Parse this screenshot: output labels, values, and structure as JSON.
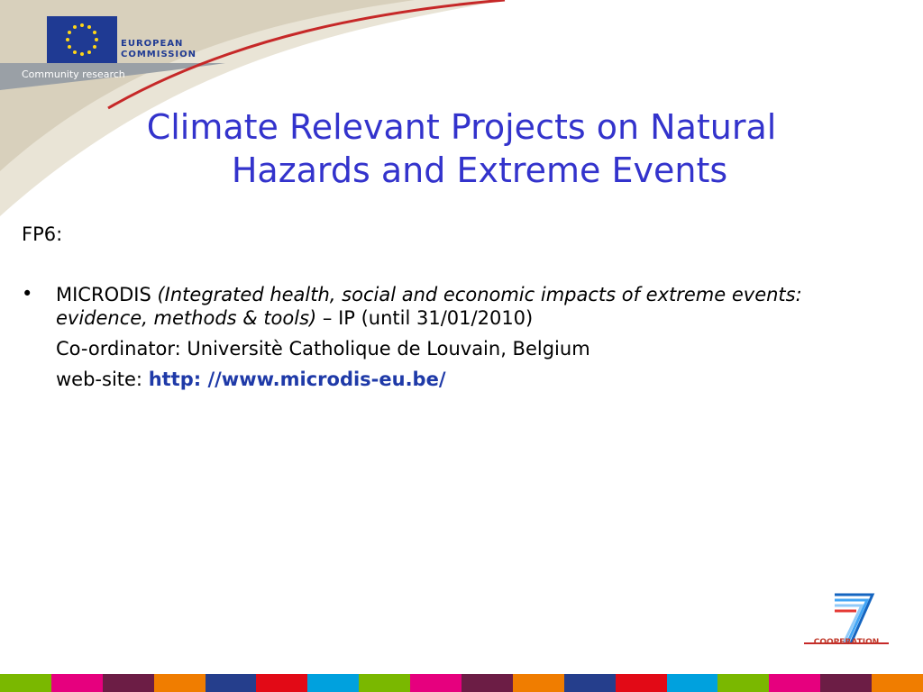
{
  "header": {
    "org_line1": "EUROPEAN",
    "org_line2": "COMMISSION",
    "subline": "Community research"
  },
  "title": {
    "line1": "Climate Relevant Projects on Natural",
    "line2": "Hazards and Extreme Events"
  },
  "program_label": "FP6:",
  "project": {
    "name": "MICRODIS",
    "description": "(Integrated health, social and economic impacts of extreme events: evidence, methods & tools)",
    "type": " – IP (until 31/01/2010)",
    "coordinator": "Co-ordinator: Universitè Catholique de Louvain, Belgium",
    "website_label": "web-site: ",
    "website_url": "http: //www.microdis-eu.be/"
  },
  "footer": {
    "badge": "COOPERATION",
    "stripe_colors": [
      "#7ab800",
      "#e6007e",
      "#6c1d45",
      "#f07d00",
      "#253e8c",
      "#e20a16",
      "#00a1de",
      "#7ab800",
      "#e6007e",
      "#6c1d45",
      "#f07d00",
      "#253e8c",
      "#e20a16",
      "#00a1de",
      "#7ab800",
      "#e6007e",
      "#6c1d45",
      "#f07d00"
    ]
  },
  "colors": {
    "title": "#3333cc",
    "url": "#1f3aa8",
    "eu_blue": "#1f3a93"
  }
}
